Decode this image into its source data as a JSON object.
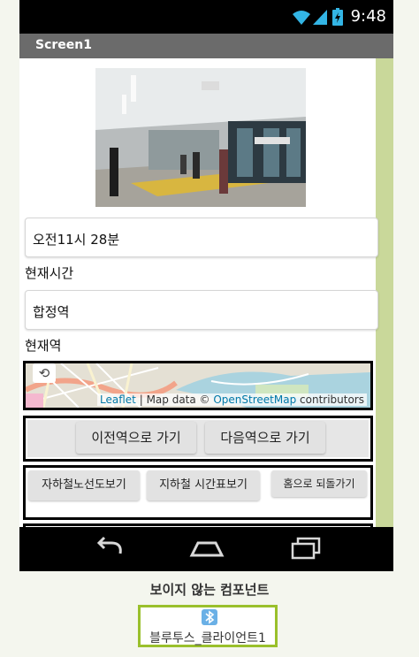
{
  "status_bar": {
    "time": "9:48"
  },
  "titlebar": {
    "title": "Screen1"
  },
  "screen": {
    "time_value": "오전11시 28분",
    "time_label": "현재시간",
    "station_value": "합정역",
    "station_label": "현재역",
    "map": {
      "attribution_leaflet": "Leaflet",
      "attribution_sep": " | Map data © ",
      "attribution_osm": "OpenStreetMap",
      "attribution_tail": " contributors"
    },
    "prev_button": "이전역으로 가기",
    "next_button": "다음역으로 가기",
    "route_map_button": "자하철노선도보기",
    "timetable_button": "지하철 시간표보기",
    "home_button": "홈으로 되돌가기"
  },
  "nonvisible": {
    "caption": "보이지 않는 컴포넌트",
    "component": "블루투스_클라이언트1"
  },
  "colors": {
    "titlebar": "#6b6b6b",
    "scroll_strip": "#c9d89a",
    "nonvisible_border": "#9ac02c",
    "link": "#0078a8"
  },
  "icons": [
    "wifi-icon",
    "signal-icon",
    "battery-icon",
    "back-icon",
    "home-icon",
    "recents-icon",
    "reset-view-icon",
    "bluetooth-icon"
  ]
}
